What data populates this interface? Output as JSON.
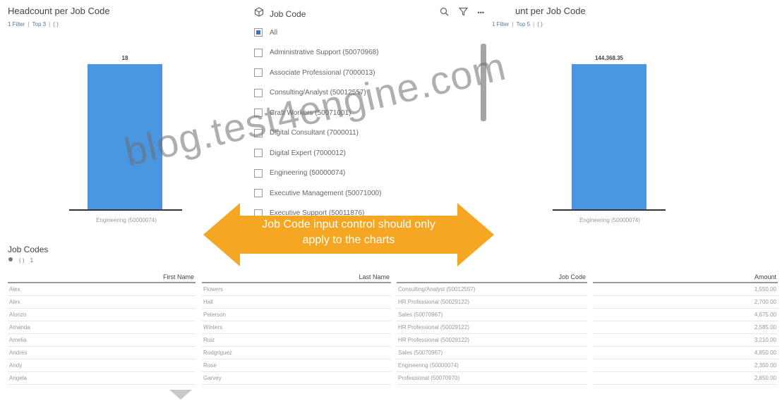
{
  "left_chart": {
    "title": "Headcount per Job Code",
    "filter_link": "1 Filter",
    "top_link": "Top 3",
    "braces": "( )",
    "value_label": "18",
    "category_label": "Engineering (50000074)"
  },
  "right_chart": {
    "title": "unt per Job Code",
    "more": "•••",
    "filter_link": "1 Filter",
    "top_link": "Top 5",
    "braces": "( )",
    "value_label": "144,368.35",
    "category_label": "Engineering (50000074)"
  },
  "chart_data": [
    {
      "type": "bar",
      "title": "Headcount per Job Code",
      "categories": [
        "Engineering (50000074)"
      ],
      "values": [
        18
      ],
      "ylim": [
        0,
        21
      ]
    },
    {
      "type": "bar",
      "categories": [
        "Engineering (50000074)"
      ],
      "values": [
        144368.35
      ],
      "ylim": [
        0,
        168000
      ]
    }
  ],
  "popup": {
    "title": "Job Code",
    "cube_icon": "cube-icon",
    "search_icon": "search-icon",
    "filter_icon": "filter-icon",
    "options": [
      {
        "label": "All",
        "checked": true
      },
      {
        "label": "Administrative Support (50070968)",
        "checked": false
      },
      {
        "label": "Associate Professional (7000013)",
        "checked": false
      },
      {
        "label": "Consulting/Analyst (50012557)",
        "checked": false
      },
      {
        "label": "Craft Workers (50071001)",
        "checked": false
      },
      {
        "label": "Digital Consultant (7000011)",
        "checked": false
      },
      {
        "label": "Digital Expert (7000012)",
        "checked": false
      },
      {
        "label": "Engineering (50000074)",
        "checked": false
      },
      {
        "label": "Executive Management (50071000)",
        "checked": false
      },
      {
        "label": "Executive Support (50011876)",
        "checked": false
      }
    ]
  },
  "watermark": "blog.test4engine.com",
  "callout": {
    "line1": "Job Code input control should only",
    "line2": "apply to the charts",
    "color": "#f5a623"
  },
  "table": {
    "title": "Job Codes",
    "braces": "( )",
    "count": "1",
    "columns": [
      "First Name",
      "Last Name",
      "Job Code",
      "Amount"
    ],
    "rows": [
      [
        "Alex",
        "Flowers",
        "Consulting/Analyst (50012557)",
        "1,550.00"
      ],
      [
        "Alex",
        "Hall",
        "HR Professional (50029122)",
        "2,700.00"
      ],
      [
        "Alonzo",
        "Peterson",
        "Sales (50070967)",
        "4,675.00"
      ],
      [
        "Amanda",
        "Winters",
        "HR Professional (50029122)",
        "2,585.00"
      ],
      [
        "Amelia",
        "Ruiz",
        "HR Professional (50029122)",
        "3,210.00"
      ],
      [
        "Andres",
        "Rodgriguez",
        "Sales (50070967)",
        "4,850.00"
      ],
      [
        "Andy",
        "Rose",
        "Engineering (50000074)",
        "2,350.00"
      ],
      [
        "Angela",
        "Garvey",
        "Professional (50070970)",
        "2,850.00"
      ]
    ]
  },
  "colors": {
    "bar": "#4b96e0",
    "accent": "#427cac"
  }
}
